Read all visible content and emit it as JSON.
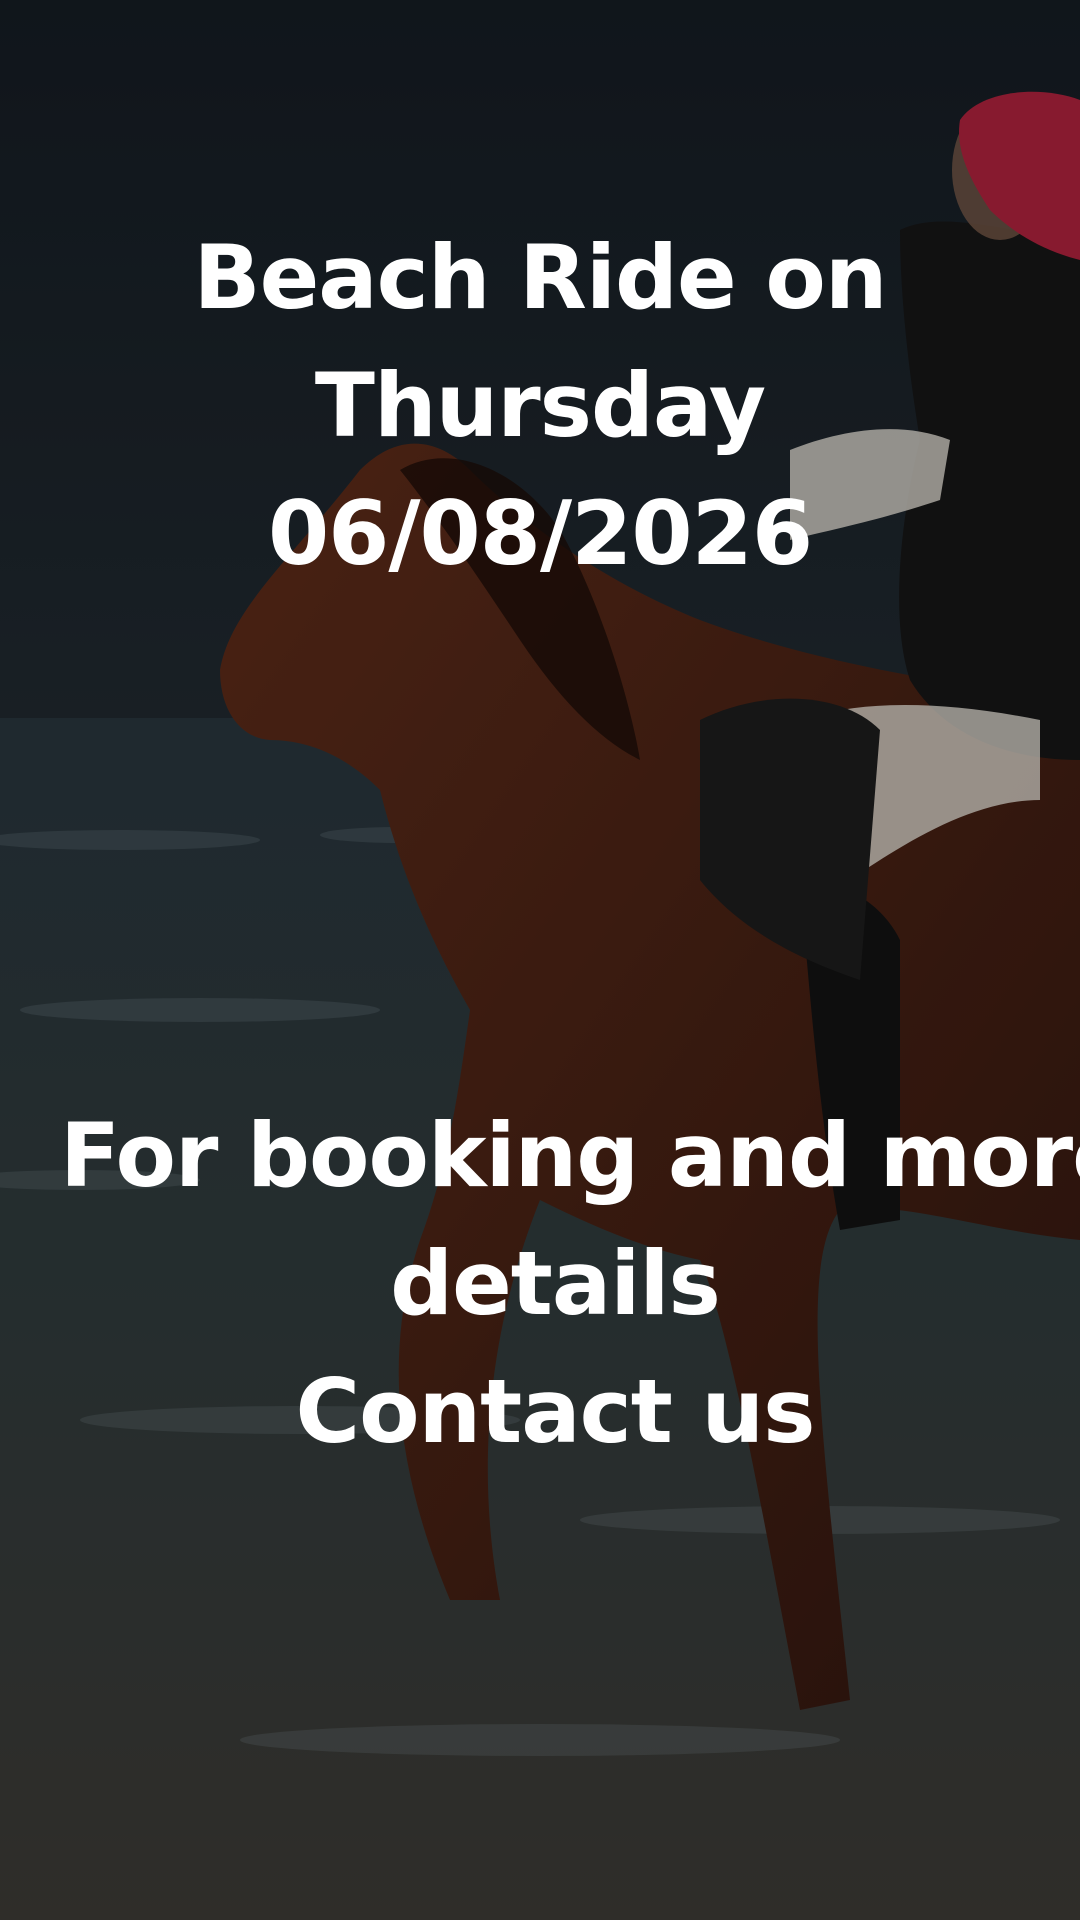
{
  "story": {
    "title_lines": [
      "Beach Ride on",
      "Thursday",
      "06/08/2026"
    ],
    "cta_lines": [
      "For booking and more",
      "details",
      "Contact us"
    ]
  },
  "colors": {
    "text": "#ffffff",
    "sky_dark": "#1c242b",
    "sea": "#2c373c",
    "sand": "#39352f",
    "horse": "#4a2416",
    "hijab": "#a5203a"
  },
  "icons": {
    "background": "beach-horse-rider-photo"
  }
}
